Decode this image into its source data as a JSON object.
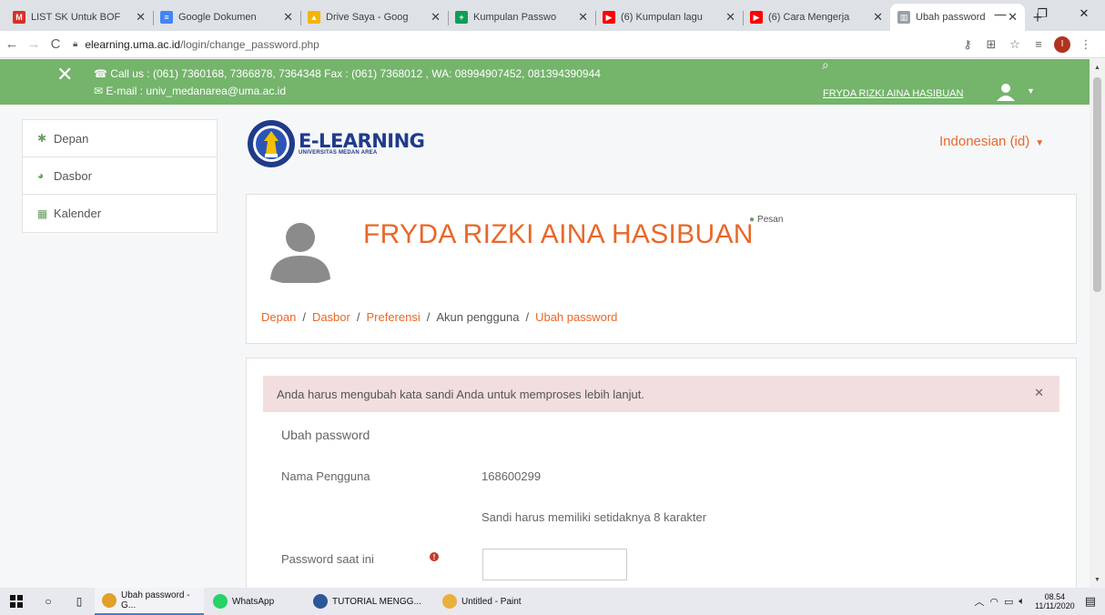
{
  "browser": {
    "tabs": [
      {
        "title": "LIST SK Untuk BOF",
        "icon": "gmail-icon",
        "color": "#d93025",
        "glyph": "M"
      },
      {
        "title": "Google Dokumen",
        "icon": "docs-icon",
        "color": "#4285f4",
        "glyph": "≡"
      },
      {
        "title": "Drive Saya - Goog",
        "icon": "drive-icon",
        "color": "#f4b400",
        "glyph": "▲"
      },
      {
        "title": "Kumpulan Passwo",
        "icon": "sheets-icon",
        "color": "#0f9d58",
        "glyph": "+"
      },
      {
        "title": "(6) Kumpulan lagu",
        "icon": "youtube-icon",
        "color": "#ff0000",
        "glyph": "▶"
      },
      {
        "title": "(6) Cara Mengerja",
        "icon": "youtube-icon",
        "color": "#ff0000",
        "glyph": "▶"
      },
      {
        "title": "Ubah password",
        "icon": "moodle-icon",
        "color": "#9aa0a6",
        "glyph": "▥",
        "active": true
      }
    ],
    "url_host": "elearning.uma.ac.id",
    "url_path": "/login/change_password.php"
  },
  "site": {
    "contact_call": "Call us : (061) 7360168, 7366878, 7364348 Fax : (061) 7368012 , WA: 08994907452, 081394390944",
    "contact_email": "E-mail : univ_medanarea@uma.ac.id",
    "user_name": "FRYDA RIZKI AINA HASIBUAN",
    "logo_title": "E-LEARNING",
    "logo_subtitle": "UNIVERSITAS MEDAN AREA",
    "language": "Indonesian (id)",
    "accent_color": "#e8682a",
    "topbar_color": "#74b46b"
  },
  "sidebar": {
    "items": [
      {
        "label": "Depan",
        "icon": "home-icon",
        "glyph": "✱"
      },
      {
        "label": "Dasbor",
        "icon": "dashboard-icon",
        "glyph": "◕"
      },
      {
        "label": "Kalender",
        "icon": "calendar-icon",
        "glyph": "▦"
      }
    ]
  },
  "profile": {
    "full_name": "FRYDA RIZKI AINA HASIBUAN",
    "message_label": "Pesan",
    "breadcrumb": [
      {
        "label": "Depan",
        "link": true
      },
      {
        "label": "Dasbor",
        "link": true
      },
      {
        "label": "Preferensi",
        "link": true
      },
      {
        "label": "Akun pengguna",
        "link": false
      },
      {
        "label": "Ubah password",
        "link": true
      }
    ]
  },
  "form": {
    "alert": "Anda harus mengubah kata sandi Anda untuk memproses lebih lanjut.",
    "heading": "Ubah password",
    "username_label": "Nama Pengguna",
    "username_value": "168600299",
    "password_rule": "Sandi harus memiliki setidaknya 8 karakter",
    "current_password_label": "Password saat ini",
    "current_password_value": ""
  },
  "taskbar": {
    "apps": [
      {
        "label": "Ubah password - G...",
        "icon": "chrome-icon",
        "color": "#e0a029",
        "open": true
      },
      {
        "label": "WhatsApp",
        "icon": "whatsapp-icon",
        "color": "#25d366",
        "open": false
      },
      {
        "label": "TUTORIAL MENGG...",
        "icon": "word-icon",
        "color": "#2b579a",
        "open": false
      },
      {
        "label": "Untitled - Paint",
        "icon": "paint-icon",
        "color": "#e9b03b",
        "open": false
      }
    ],
    "time": "08.54",
    "date": "11/11/2020"
  }
}
